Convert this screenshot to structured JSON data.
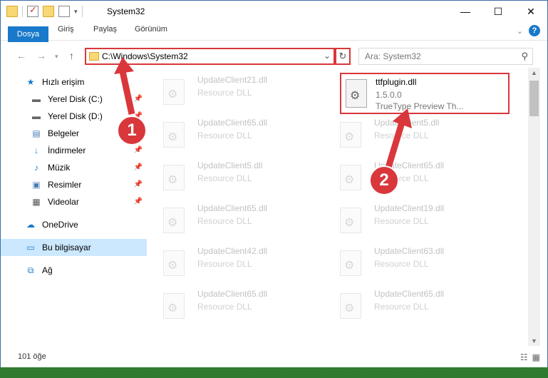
{
  "window": {
    "title": "System32"
  },
  "ribbon": {
    "file_tab": "Dosya",
    "tabs": [
      "Giriş",
      "Paylaş",
      "Görünüm"
    ]
  },
  "nav": {
    "address": "C:\\Windows\\System32",
    "search_placeholder": "Ara: System32"
  },
  "sidebar": {
    "items": [
      {
        "label": "Hızlı erişim",
        "icon": "star-icon"
      },
      {
        "label": "Yerel Disk (C:)",
        "icon": "drive-icon",
        "pinned": true
      },
      {
        "label": "Yerel Disk (D:)",
        "icon": "drive-icon",
        "pinned": true
      },
      {
        "label": "Belgeler",
        "icon": "document-icon",
        "pinned": true
      },
      {
        "label": "İndirmeler",
        "icon": "download-icon",
        "pinned": true
      },
      {
        "label": "Müzik",
        "icon": "music-icon",
        "pinned": true
      },
      {
        "label": "Resimler",
        "icon": "pictures-icon",
        "pinned": true
      },
      {
        "label": "Videolar",
        "icon": "video-icon",
        "pinned": true
      },
      {
        "label": "OneDrive",
        "icon": "cloud-icon"
      },
      {
        "label": "Bu bilgisayar",
        "icon": "computer-icon",
        "selected": true
      },
      {
        "label": "Ağ",
        "icon": "network-icon"
      }
    ]
  },
  "files": {
    "left": [
      {
        "name": "UpdateClient21.dll",
        "desc": "Resource DLL"
      },
      {
        "name": "UpdateClient65.dll",
        "desc": "Resource DLL"
      },
      {
        "name": "UpdateClient5.dll",
        "desc": "Resource DLL"
      },
      {
        "name": "UpdateClient65.dll",
        "desc": "Resource DLL"
      },
      {
        "name": "UpdateClient42.dll",
        "desc": "Resource DLL"
      },
      {
        "name": "UpdateClient65.dll",
        "desc": "Resource DLL"
      }
    ],
    "right": [
      {
        "name": "UpdateClient5.dll",
        "desc": "Resource DLL"
      },
      {
        "name": "UpdateClient65.dll",
        "desc": "Resource DLL"
      },
      {
        "name": "UpdateClient19.dll",
        "desc": "Resource DLL"
      },
      {
        "name": "UpdateClient63.dll",
        "desc": "Resource DLL"
      },
      {
        "name": "UpdateClient65.dll",
        "desc": "Resource DLL"
      }
    ],
    "highlighted": {
      "name": "ttfplugin.dll",
      "version": "1.5.0.0",
      "desc": "TrueType Preview Th..."
    }
  },
  "status": {
    "count": "101 öğe"
  },
  "annotations": {
    "step1": "1",
    "step2": "2"
  },
  "colors": {
    "accent": "#1979ca",
    "highlight": "#d9373b"
  }
}
